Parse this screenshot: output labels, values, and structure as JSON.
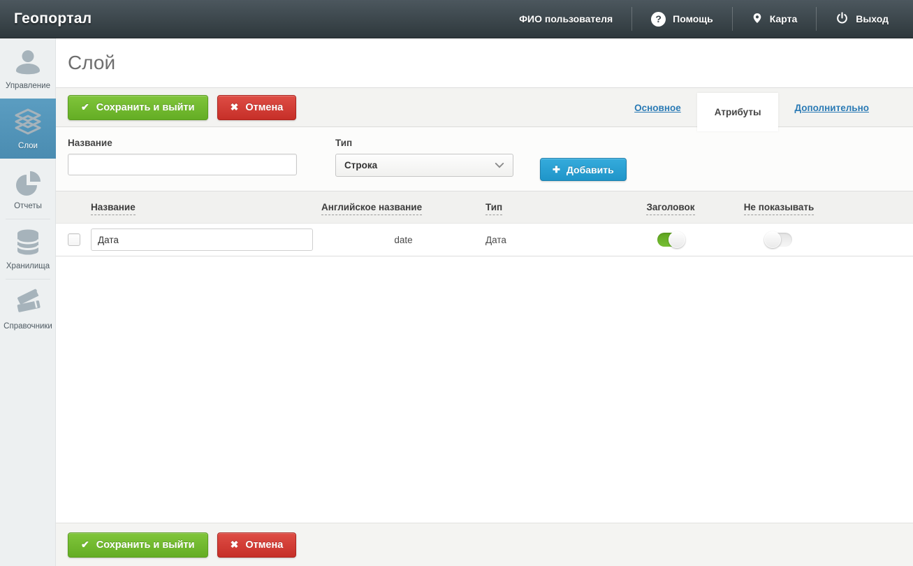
{
  "topbar": {
    "logo": "Геопортал",
    "user_name": "ФИО пользователя",
    "help": "Помощь",
    "map": "Карта",
    "logout": "Выход"
  },
  "sidebar": {
    "items": [
      {
        "label": "Управление",
        "icon": "user-icon",
        "active": false
      },
      {
        "label": "Слои",
        "icon": "layers-icon",
        "active": true
      },
      {
        "label": "Отчеты",
        "icon": "pie-chart-icon",
        "active": false
      },
      {
        "label": "Хранилища",
        "icon": "database-icon",
        "active": false
      },
      {
        "label": "Справочники",
        "icon": "books-icon",
        "active": false
      }
    ]
  },
  "page": {
    "title": "Слой"
  },
  "actions": {
    "save": "Сохранить и выйти",
    "cancel": "Отмена"
  },
  "tabs": [
    {
      "label": "Основное",
      "active": false
    },
    {
      "label": "Атрибуты",
      "active": true
    },
    {
      "label": "Дополнительно",
      "active": false
    }
  ],
  "form": {
    "name_label": "Название",
    "name_value": "",
    "type_label": "Тип",
    "type_value": "Строка",
    "add": "Добавить"
  },
  "table": {
    "headers": [
      "Название",
      "Английское название",
      "Тип",
      "Заголовок",
      "Не показывать"
    ],
    "rows": [
      {
        "name": "Дата",
        "english_name": "date",
        "type": "Дата",
        "header_enabled": true,
        "hidden_enabled": false,
        "selected": false
      }
    ]
  },
  "icons": {
    "check": "✔",
    "cross": "✖",
    "plus": "✚",
    "help_glyph": "?"
  },
  "colors": {
    "topbar_dark": "#323c40",
    "sidebar_active_blue": "#4f93b9",
    "button_green": "#6db52c",
    "button_red": "#cb2f28",
    "button_blue": "#2198cc",
    "link_blue": "#2a7ab5",
    "toggle_on_green": "#6fb52d"
  }
}
